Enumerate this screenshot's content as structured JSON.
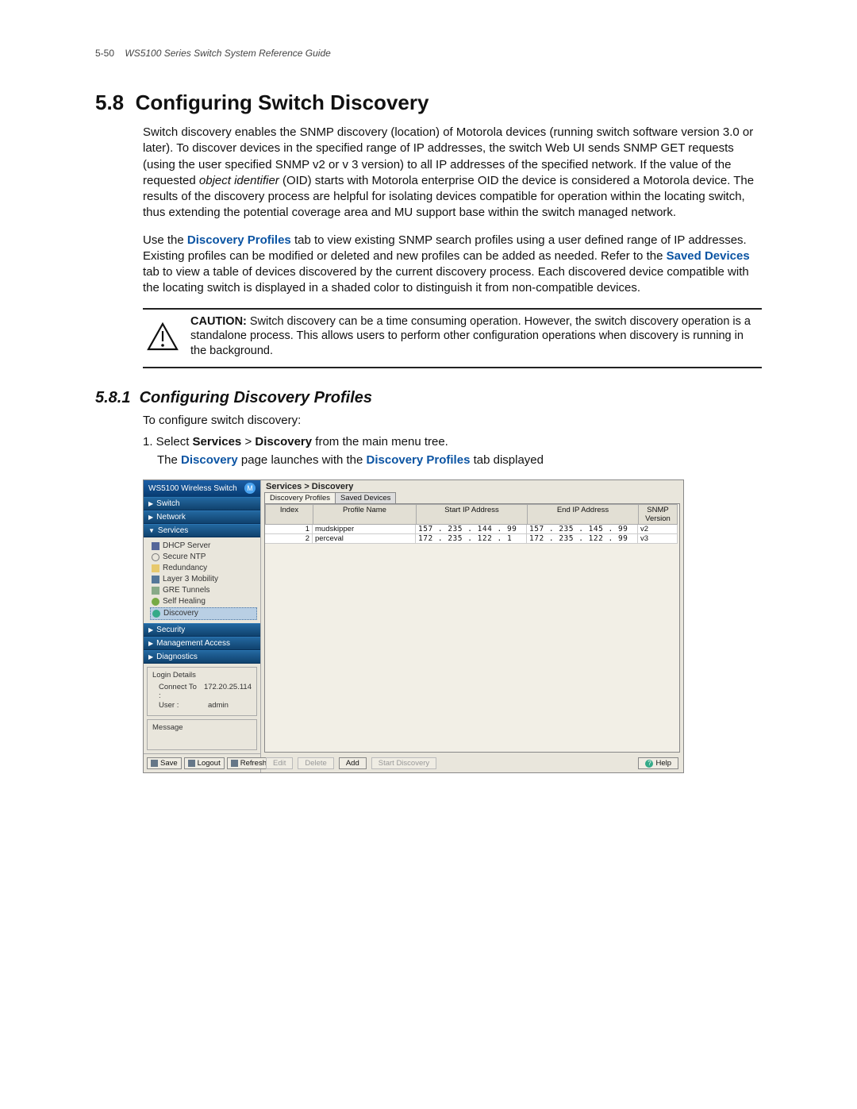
{
  "header": {
    "page_no": "5-50",
    "doc_title": "WS5100 Series Switch System Reference Guide"
  },
  "section": {
    "number": "5.8",
    "title": "Configuring Switch Discovery",
    "para1a": "Switch discovery enables the SNMP discovery (location) of Motorola devices (running switch software version 3.0 or later). To discover devices in the specified range of IP addresses, the switch Web UI sends SNMP GET requests (using the user specified SNMP v2 or v 3 version) to all IP addresses of the specified network. If the value of the requested ",
    "oid_phrase": "object identifier",
    "para1b": " (OID) starts with Motorola enterprise OID the device is considered a Motorola device. The results of the discovery process are helpful for isolating devices compatible for operation within the locating switch, thus extending the potential coverage area and MU support base within the switch managed network.",
    "para2_pre": "Use the ",
    "para2_link1": "Discovery Profiles",
    "para2_mid1": " tab to view existing SNMP search profiles using a user defined range of IP addresses. Existing profiles can be modified or deleted and new profiles can be added as needed. Refer to the ",
    "para2_link2": "Saved Devices",
    "para2_mid2": " tab to view a table of devices discovered by the current discovery process. Each discovered device compatible with the locating switch is displayed in a shaded color to distinguish it from non-compatible devices.",
    "caution_label": "CAUTION:",
    "caution_text": " Switch discovery can be a time consuming operation. However, the switch discovery operation is a standalone process. This allows users to perform other configuration operations when discovery is running in the background."
  },
  "subsection": {
    "number": "5.8.1",
    "title": "Configuring Discovery Profiles",
    "intro": "To configure switch discovery:",
    "step1_pre": "1. Select ",
    "step1_b1": "Services",
    "step1_mid": " > ",
    "step1_b2": "Discovery",
    "step1_post": " from the main menu tree.",
    "step_sub_pre": "The ",
    "step_sub_b1": "Discovery",
    "step_sub_mid": " page launches with the ",
    "step_sub_b2": "Discovery Profiles",
    "step_sub_post": " tab displayed"
  },
  "app": {
    "product": "WS5100 Wireless Switch",
    "breadcrumb": "Services > Discovery",
    "tabs": {
      "active": "Discovery Profiles",
      "other": "Saved Devices"
    },
    "nav": {
      "switch": "Switch",
      "network": "Network",
      "services": "Services",
      "services_children": [
        "DHCP Server",
        "Secure NTP",
        "Redundancy",
        "Layer 3 Mobility",
        "GRE Tunnels",
        "Self Healing",
        "Discovery"
      ],
      "security": "Security",
      "management": "Management Access",
      "diagnostics": "Diagnostics"
    },
    "login": {
      "panel_title": "Login Details",
      "connect_label": "Connect To :",
      "connect_value": "172.20.25.114",
      "user_label": "User :",
      "user_value": "admin",
      "msg_title": "Message"
    },
    "sb_buttons": {
      "save": "Save",
      "logout": "Logout",
      "refresh": "Refresh"
    },
    "table": {
      "headers": [
        "Index",
        "Profile Name",
        "Start IP Address",
        "End IP Address",
        "SNMP Version"
      ],
      "rows": [
        {
          "index": "1",
          "name": "mudskipper",
          "start": "157 . 235 . 144 .  99",
          "end": "157 . 235 . 145 .  99",
          "ver": "v2"
        },
        {
          "index": "2",
          "name": "perceval",
          "start": "172 . 235 . 122 .   1",
          "end": "172 . 235 . 122 .  99",
          "ver": "v3"
        }
      ]
    },
    "buttons": {
      "edit": "Edit",
      "delete": "Delete",
      "add": "Add",
      "start": "Start Discovery",
      "help": "Help"
    }
  }
}
